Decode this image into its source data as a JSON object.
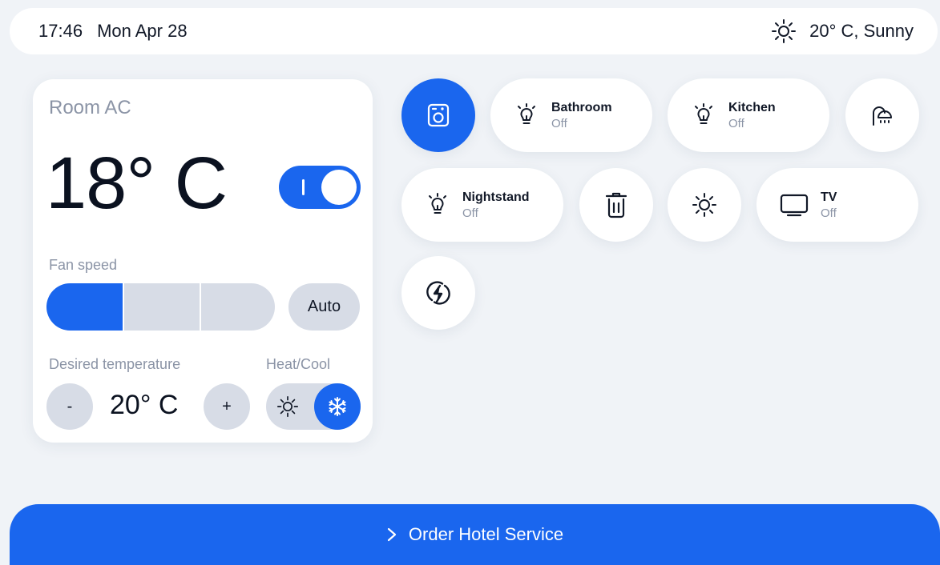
{
  "status_bar": {
    "time": "17:46",
    "date": "Mon Apr 28",
    "weather": "20° C, Sunny",
    "weather_icon": "sun-icon"
  },
  "ac": {
    "title": "Room AC",
    "current_temp": "18° C",
    "power_on": true,
    "fan_speed_label": "Fan speed",
    "fan_speed_level": 1,
    "fan_speed_levels": 3,
    "auto_label": "Auto",
    "desired_label": "Desired temperature",
    "desired_value": "20° C",
    "minus_label": "-",
    "plus_label": "+",
    "heat_cool_label": "Heat/Cool",
    "mode": "cool"
  },
  "devices": [
    {
      "name": "",
      "status": "",
      "icon": "washing-machine-icon",
      "active": true
    },
    {
      "name": "Bathroom",
      "status": "Off",
      "icon": "lightbulb-icon"
    },
    {
      "name": "Kitchen",
      "status": "Off",
      "icon": "lightbulb-icon"
    },
    {
      "name": "",
      "status": "",
      "icon": "shower-icon"
    },
    {
      "name": "Nightstand",
      "status": "Off",
      "icon": "lightbulb-icon"
    },
    {
      "name": "",
      "status": "",
      "icon": "trash-icon"
    },
    {
      "name": "",
      "status": "",
      "icon": "sun-icon"
    },
    {
      "name": "TV",
      "status": "Off",
      "icon": "tv-icon"
    },
    {
      "name": "",
      "status": "",
      "icon": "energy-icon"
    }
  ],
  "footer": {
    "order_label": "Order Hotel Service"
  },
  "colors": {
    "accent": "#1a66ee",
    "background": "#f0f3f7",
    "inactive": "#d7dce6",
    "muted_text": "#8b94a6"
  }
}
